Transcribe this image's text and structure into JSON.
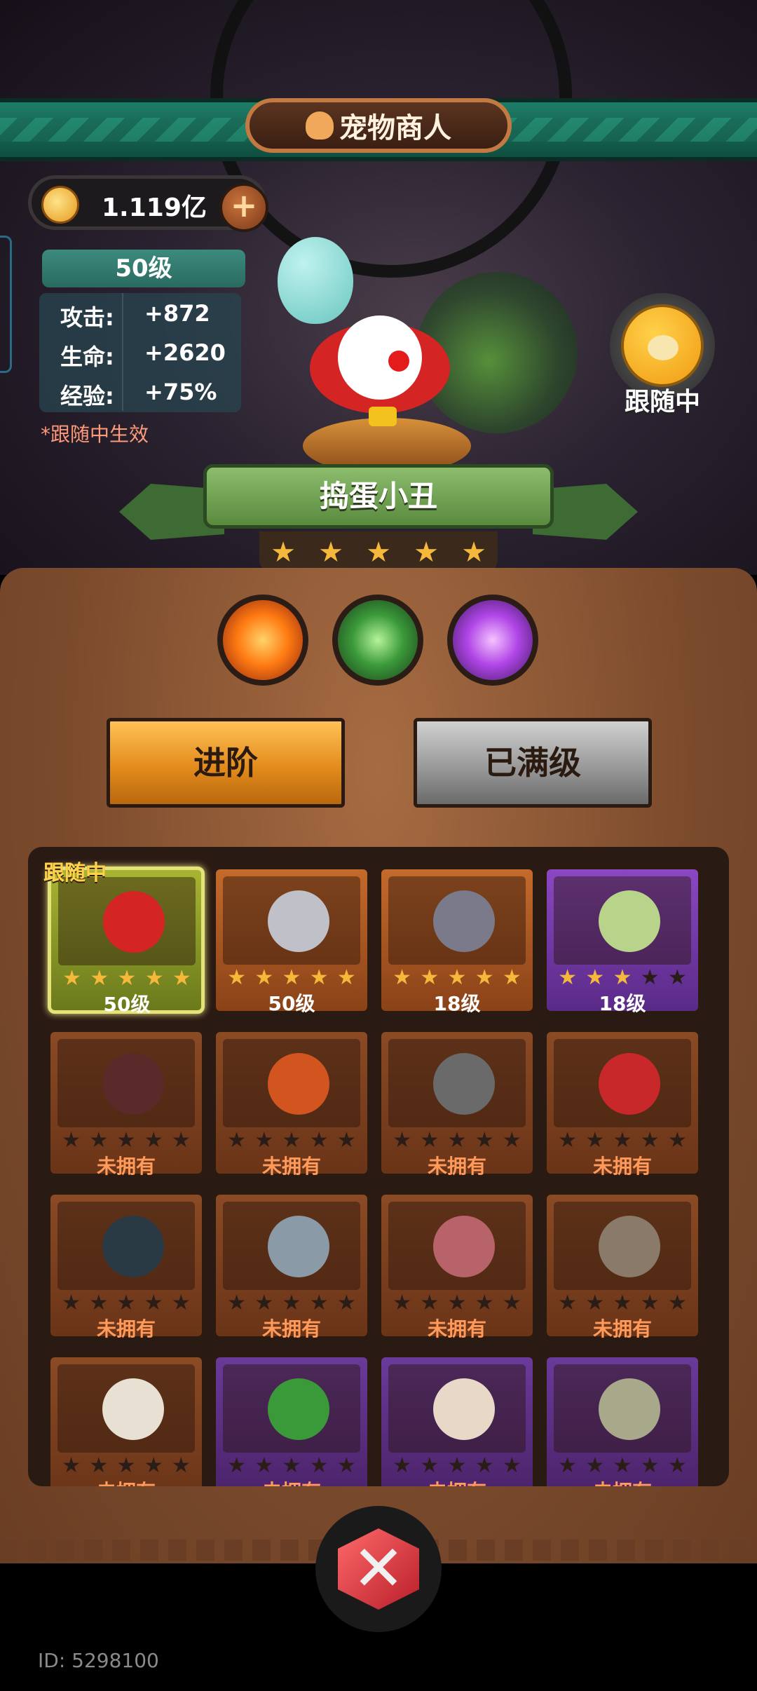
{
  "header": {
    "title": "宠物商人"
  },
  "currency": {
    "value": "1.119亿"
  },
  "pet": {
    "level": "50级",
    "stats": [
      {
        "label": "攻击:",
        "value": "+872"
      },
      {
        "label": "生命:",
        "value": "+2620"
      },
      {
        "label": "经验:",
        "value": "+75%"
      }
    ],
    "note": "*跟随中生效",
    "name": "捣蛋小丑",
    "stars": 5
  },
  "follow": {
    "label": "跟随中"
  },
  "skills": [
    "fire-orb-icon",
    "claw-slash-icon",
    "speech-bubble-icon"
  ],
  "buttons": {
    "advance": "进阶",
    "maxed": "已满级"
  },
  "grid": {
    "following_tag": "跟随中",
    "cards": [
      {
        "label": "50级",
        "stars": 5,
        "style": "selected",
        "color": "#d42424"
      },
      {
        "label": "50级",
        "stars": 5,
        "style": "orange",
        "color": "#c0c0c8"
      },
      {
        "label": "18级",
        "stars": 5,
        "style": "orange",
        "color": "#7a7a8a"
      },
      {
        "label": "18级",
        "stars": 3,
        "style": "purple",
        "color": "#b8d48a"
      },
      {
        "label": "未拥有",
        "stars": 0,
        "style": "locked",
        "color": "#5a2a2a"
      },
      {
        "label": "未拥有",
        "stars": 0,
        "style": "locked",
        "color": "#d2541e"
      },
      {
        "label": "未拥有",
        "stars": 0,
        "style": "locked",
        "color": "#6a6a6a"
      },
      {
        "label": "未拥有",
        "stars": 0,
        "style": "locked",
        "color": "#c8282a"
      },
      {
        "label": "未拥有",
        "stars": 0,
        "style": "locked",
        "color": "#2a3a44"
      },
      {
        "label": "未拥有",
        "stars": 0,
        "style": "locked",
        "color": "#8a9aa6"
      },
      {
        "label": "未拥有",
        "stars": 0,
        "style": "locked",
        "color": "#b8626a"
      },
      {
        "label": "未拥有",
        "stars": 0,
        "style": "locked",
        "color": "#8a7a6a"
      },
      {
        "label": "未拥有",
        "stars": 0,
        "style": "locked",
        "color": "#e8e0d2"
      },
      {
        "label": "未拥有",
        "stars": 0,
        "style": "locked purple",
        "color": "#3a9a3a"
      },
      {
        "label": "未拥有",
        "stars": 0,
        "style": "locked purple",
        "color": "#e8d8c8"
      },
      {
        "label": "未拥有",
        "stars": 0,
        "style": "locked purple",
        "color": "#a8a88a"
      }
    ]
  },
  "footer": {
    "user_id": "ID: 5298100"
  },
  "colors": {
    "accent_gold": "#f5b83a",
    "header_green": "#1e7d67",
    "panel_brown": "#7a4a2c"
  }
}
